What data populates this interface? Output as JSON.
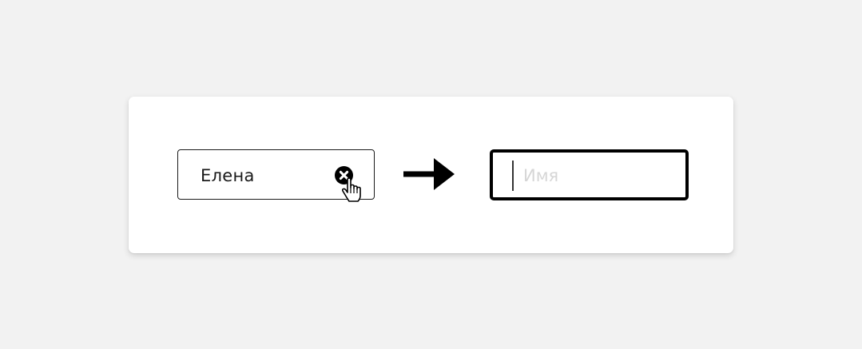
{
  "filled_field": {
    "value": "Елена",
    "clear_icon": "close-circle-icon",
    "cursor_icon": "hand-pointer-cursor-icon"
  },
  "transition_icon": "right-arrow-icon",
  "empty_field": {
    "placeholder": "Имя"
  },
  "colors": {
    "background": "#f2f2f2",
    "card": "#ffffff",
    "border": "#000000",
    "placeholder": "#d6d6d6"
  }
}
